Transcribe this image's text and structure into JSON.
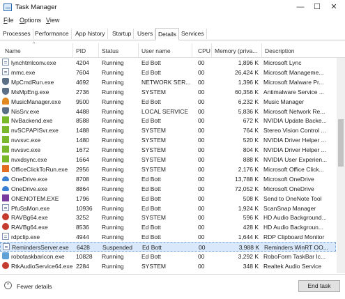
{
  "window": {
    "title": "Task Manager",
    "minimize": "—",
    "maximize": "☐",
    "close": "✕"
  },
  "menu": [
    {
      "underline": "F",
      "rest": "ile"
    },
    {
      "underline": "O",
      "rest": "ptions"
    },
    {
      "underline": "V",
      "rest": "iew"
    }
  ],
  "tabs": [
    "Processes",
    "Performance",
    "App history",
    "Startup",
    "Users",
    "Details",
    "Services"
  ],
  "active_tab": "Details",
  "columns": [
    "Name",
    "PID",
    "Status",
    "User name",
    "CPU",
    "Memory (priva...",
    "Description"
  ],
  "rows": [
    {
      "icon": "doc-icon",
      "name": "lynchtmlconv.exe",
      "pid": "4204",
      "status": "Running",
      "user": "Ed Bott",
      "cpu": "00",
      "mem": "1,896 K",
      "desc": "Microsoft Lync"
    },
    {
      "icon": "doc-icon",
      "name": "mmc.exe",
      "pid": "7604",
      "status": "Running",
      "user": "Ed Bott",
      "cpu": "00",
      "mem": "26,424 K",
      "desc": "Microsoft Manageme..."
    },
    {
      "icon": "shield-icon",
      "name": "MpCmdRun.exe",
      "pid": "4692",
      "status": "Running",
      "user": "NETWORK SER...",
      "cpu": "00",
      "mem": "1,396 K",
      "desc": "Microsoft Malware Pr..."
    },
    {
      "icon": "shield-icon",
      "name": "MsMpEng.exe",
      "pid": "2736",
      "status": "Running",
      "user": "SYSTEM",
      "cpu": "00",
      "mem": "60,356 K",
      "desc": "Antimalware Service ..."
    },
    {
      "icon": "headphones-icon",
      "name": "MusicManager.exe",
      "pid": "9500",
      "status": "Running",
      "user": "Ed Bott",
      "cpu": "00",
      "mem": "6,232 K",
      "desc": "Music Manager"
    },
    {
      "icon": "shield-icon",
      "name": "NisSrv.exe",
      "pid": "4488",
      "status": "Running",
      "user": "LOCAL SERVICE",
      "cpu": "00",
      "mem": "5,836 K",
      "desc": "Microsoft Network Re..."
    },
    {
      "icon": "nvidia-icon",
      "name": "NvBackend.exe",
      "pid": "8588",
      "status": "Running",
      "user": "Ed Bott",
      "cpu": "00",
      "mem": "672 K",
      "desc": "NVIDIA Update Backe..."
    },
    {
      "icon": "nvidia-icon",
      "name": "nvSCPAPISvr.exe",
      "pid": "1488",
      "status": "Running",
      "user": "SYSTEM",
      "cpu": "00",
      "mem": "764 K",
      "desc": "Stereo Vision Control ..."
    },
    {
      "icon": "nvidia-icon",
      "name": "nvvsvc.exe",
      "pid": "1480",
      "status": "Running",
      "user": "SYSTEM",
      "cpu": "00",
      "mem": "520 K",
      "desc": "NVIDIA Driver Helper ..."
    },
    {
      "icon": "nvidia-icon",
      "name": "nvvsvc.exe",
      "pid": "1672",
      "status": "Running",
      "user": "SYSTEM",
      "cpu": "00",
      "mem": "804 K",
      "desc": "NVIDIA Driver Helper ..."
    },
    {
      "icon": "nvidia-icon",
      "name": "nvxdsync.exe",
      "pid": "1664",
      "status": "Running",
      "user": "SYSTEM",
      "cpu": "00",
      "mem": "888 K",
      "desc": "NVIDIA User Experien..."
    },
    {
      "icon": "office-icon",
      "name": "OfficeClickToRun.exe",
      "pid": "2956",
      "status": "Running",
      "user": "SYSTEM",
      "cpu": "00",
      "mem": "2,176 K",
      "desc": "Microsoft Office Click..."
    },
    {
      "icon": "cloud-icon",
      "name": "OneDrive.exe",
      "pid": "8708",
      "status": "Running",
      "user": "Ed Bott",
      "cpu": "00",
      "mem": "13,788 K",
      "desc": "Microsoft OneDrive"
    },
    {
      "icon": "cloud-icon",
      "name": "OneDrive.exe",
      "pid": "8864",
      "status": "Running",
      "user": "Ed Bott",
      "cpu": "00",
      "mem": "72,052 K",
      "desc": "Microsoft OneDrive"
    },
    {
      "icon": "onenote-icon",
      "name": "ONENOTEM.EXE",
      "pid": "1796",
      "status": "Running",
      "user": "Ed Bott",
      "cpu": "00",
      "mem": "508 K",
      "desc": "Send to OneNote Tool"
    },
    {
      "icon": "doc-icon",
      "name": "PfuSsMon.exe",
      "pid": "10936",
      "status": "Running",
      "user": "Ed Bott",
      "cpu": "00",
      "mem": "1,924 K",
      "desc": "ScanSnap Manager"
    },
    {
      "icon": "speaker-icon",
      "name": "RAVBg64.exe",
      "pid": "3252",
      "status": "Running",
      "user": "SYSTEM",
      "cpu": "00",
      "mem": "596 K",
      "desc": "HD Audio Background..."
    },
    {
      "icon": "speaker-icon",
      "name": "RAVBg64.exe",
      "pid": "8536",
      "status": "Running",
      "user": "Ed Bott",
      "cpu": "00",
      "mem": "428 K",
      "desc": "HD Audio Backgroun..."
    },
    {
      "icon": "doc-icon",
      "name": "rdpclip.exe",
      "pid": "4944",
      "status": "Running",
      "user": "Ed Bott",
      "cpu": "00",
      "mem": "1,644 K",
      "desc": "RDP Clipboard Monitor"
    },
    {
      "icon": "doc-icon",
      "name": "RemindersServer.exe",
      "pid": "6428",
      "status": "Suspended",
      "user": "Ed Bott",
      "cpu": "00",
      "mem": "3,988 K",
      "desc": "Reminders WinRT OO..."
    },
    {
      "icon": "robot-icon",
      "name": "robotaskbaricon.exe",
      "pid": "10828",
      "status": "Running",
      "user": "Ed Bott",
      "cpu": "00",
      "mem": "3,292 K",
      "desc": "RoboForm TaskBar Ic..."
    },
    {
      "icon": "speaker-icon",
      "name": "RtkAudioService64.exe",
      "pid": "2284",
      "status": "Running",
      "user": "SYSTEM",
      "cpu": "00",
      "mem": "348 K",
      "desc": "Realtek Audio Service"
    }
  ],
  "selected_row": 19,
  "footer": {
    "fewer_details": "Fewer details",
    "end_task": "End task"
  },
  "colors": {
    "selection": "#d9e9fb",
    "accent": "#2f6fc2"
  }
}
